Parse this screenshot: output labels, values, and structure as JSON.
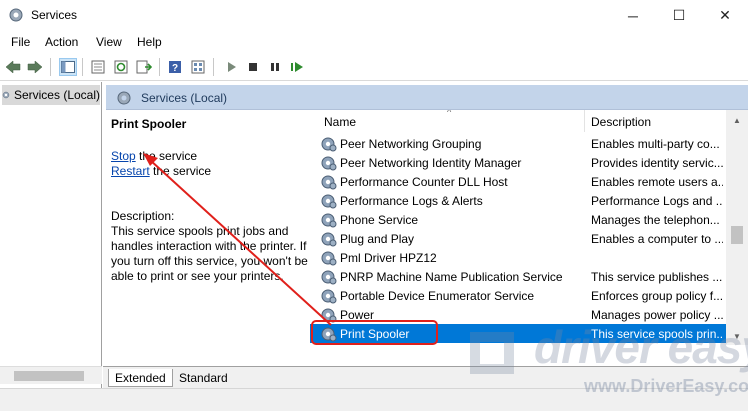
{
  "window": {
    "title": "Services",
    "controls": {
      "minimize": "─",
      "maximize": "☐",
      "close": "✕"
    }
  },
  "menu": [
    "File",
    "Action",
    "View",
    "Help"
  ],
  "tree": {
    "root_label": "Services (Local)"
  },
  "header": {
    "title": "Services (Local)"
  },
  "detail": {
    "title": "Print Spooler",
    "stop_link": "Stop",
    "stop_suffix": " the service",
    "restart_link": "Restart",
    "restart_suffix": " the service",
    "description_label": "Description:",
    "description_text": "This service spools print jobs and handles interaction with the printer. If you turn off this service, you won't be able to print or see your printers."
  },
  "columns": {
    "name": "Name",
    "description": "Description",
    "sort_indicator": "^"
  },
  "rows": [
    {
      "name": "Peer Networking Grouping",
      "description": "Enables multi-party co..."
    },
    {
      "name": "Peer Networking Identity Manager",
      "description": "Provides identity servic..."
    },
    {
      "name": "Performance Counter DLL Host",
      "description": "Enables remote users a..."
    },
    {
      "name": "Performance Logs & Alerts",
      "description": "Performance Logs and ..."
    },
    {
      "name": "Phone Service",
      "description": "Manages the telephon..."
    },
    {
      "name": "Plug and Play",
      "description": "Enables a computer to ..."
    },
    {
      "name": "Pml Driver HPZ12",
      "description": ""
    },
    {
      "name": "PNRP Machine Name Publication Service",
      "description": "This service publishes ..."
    },
    {
      "name": "Portable Device Enumerator Service",
      "description": "Enforces group policy f..."
    },
    {
      "name": "Power",
      "description": "Manages power policy ..."
    },
    {
      "name": "Print Spooler",
      "description": "This service spools prin..."
    }
  ],
  "selected_row": "Print Spooler",
  "tabs": {
    "extended": "Extended",
    "standard": "Standard"
  },
  "watermark": {
    "brand": "driver easy",
    "url": "www.DriverEasy.com"
  },
  "colors": {
    "selection": "#0078d7",
    "annotation": "#e0201b",
    "header_bg": "#c3d4ea"
  },
  "icons": [
    "services-gear-icon",
    "back-arrow-icon",
    "forward-arrow-icon",
    "show-tree-icon",
    "properties-icon",
    "refresh-icon",
    "export-icon",
    "help-icon",
    "view-icon",
    "start-icon",
    "stop-icon",
    "pause-icon",
    "restart-icon"
  ]
}
